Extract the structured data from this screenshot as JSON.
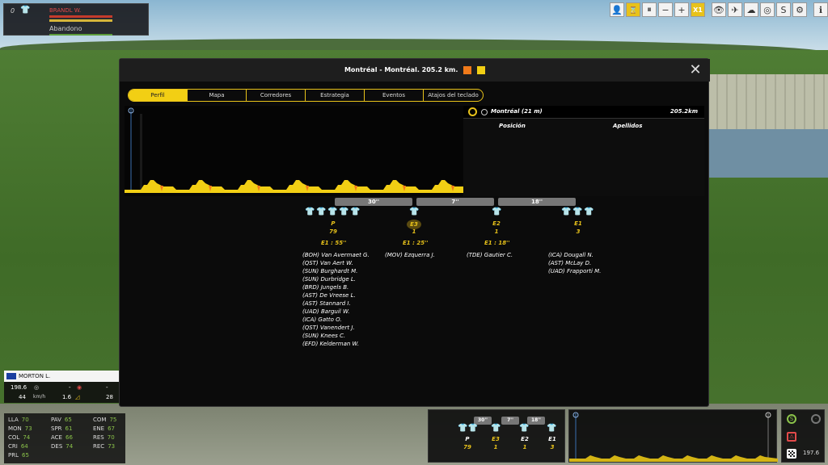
{
  "top_rider": {
    "number": "0",
    "name": "BRANDL W.",
    "status": "Abandono"
  },
  "toolbar": {
    "speed_label": "X1",
    "icons": [
      "rider-icon",
      "hourglass-icon",
      "pause-icon",
      "minus-icon",
      "plus-icon",
      "speed-x1",
      "eye-icon",
      "helicopter-icon",
      "weather-icon",
      "target-icon",
      "s-icon",
      "gear-2-icon",
      "info-icon",
      "settings-icon"
    ]
  },
  "dialog": {
    "title": "Montréal - Montréal. 205.2 km.",
    "close_glyph": "✕",
    "tabs": [
      "Perfil",
      "Mapa",
      "Corredores",
      "Estrategia",
      "Eventos",
      "Atajos del teclado"
    ],
    "active_tab": "Perfil",
    "right_panel": {
      "location": "Montréal (21 m)",
      "distance": "205.2km",
      "col_position": "Posición",
      "col_surname": "Apellidos"
    },
    "gaps": [
      "30''",
      "7''",
      "18''"
    ],
    "groups": [
      {
        "label": "P",
        "count": "79",
        "time": "E1 : 55''",
        "riders": [
          "(BOH) Van Avermaet G.",
          "(QST) Van Aert W.",
          "(SUN) Burghardt M.",
          "(SUN) Durbridge L.",
          "(BRD) Jungels B.",
          "(AST) De Vreese L.",
          "(AST) Stannard I.",
          "(UAD) Barguil W.",
          "(ICA) Gatto O.",
          "(QST) Vanendert J.",
          "(SUN) Knees C.",
          "(EFD) Kelderman W."
        ]
      },
      {
        "label": "E3",
        "count": "1",
        "time": "E1 : 25''",
        "riders": [
          "(MOV) Ezquerra J."
        ]
      },
      {
        "label": "E2",
        "count": "1",
        "time": "E1 : 18''",
        "riders": [
          "(TDE) Gautier C."
        ]
      },
      {
        "label": "E1",
        "count": "3",
        "time": "",
        "riders": [
          "(ICA) Dougall N.",
          "(AST) McLay D.",
          "(UAD) Frapporti M."
        ]
      }
    ]
  },
  "rider_panel": {
    "name": "MORTON L.",
    "distance": "198.6",
    "speed": "44",
    "speed_unit": "km/h",
    "dash1": "-",
    "gradient": "1.6",
    "dash2": "-",
    "value28": "28",
    "stats": [
      {
        "k": "LLA",
        "v": "70"
      },
      {
        "k": "MON",
        "v": "73"
      },
      {
        "k": "COL",
        "v": "74"
      },
      {
        "k": "CRI",
        "v": "64"
      },
      {
        "k": "PRL",
        "v": "65"
      },
      {
        "k": "PAV",
        "v": "65"
      },
      {
        "k": "SPR",
        "v": "61"
      },
      {
        "k": "ACE",
        "v": "66"
      },
      {
        "k": "DES",
        "v": "74"
      },
      {
        "k": "COM",
        "v": "75"
      },
      {
        "k": "ENE",
        "v": "67"
      },
      {
        "k": "RES",
        "v": "70"
      },
      {
        "k": "REC",
        "v": "73"
      }
    ]
  },
  "mini": {
    "gaps": [
      "30''",
      "7''",
      "18''"
    ],
    "labels": [
      "P",
      "E3",
      "E2",
      "E1"
    ],
    "counts": [
      "79",
      "1",
      "1",
      "3"
    ],
    "remaining": "197.6"
  },
  "colors": {
    "accent": "#f2cf14",
    "panel": "#0b0b0b",
    "orange_jersey": "#f07a1a"
  }
}
